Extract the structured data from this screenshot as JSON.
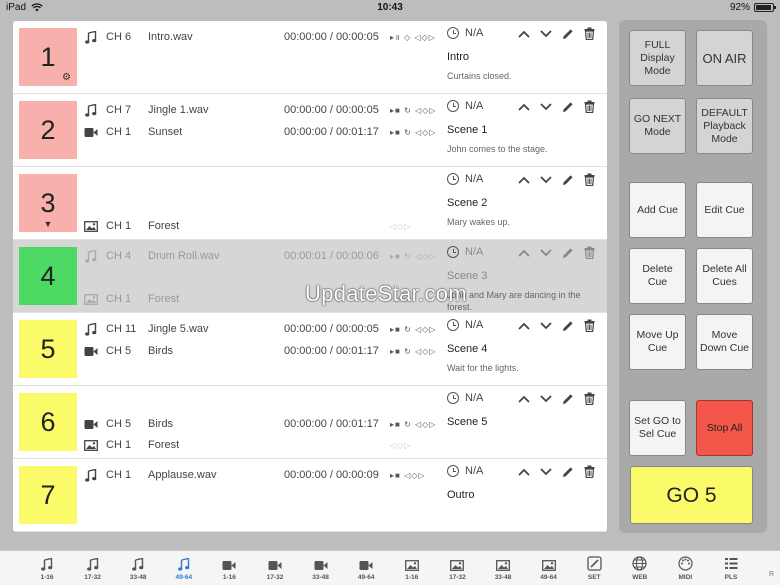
{
  "status_bar": {
    "device": "iPad",
    "time": "10:43",
    "battery_percent": "92%",
    "battery_level": 0.92
  },
  "cues": [
    {
      "number": "1",
      "color": "#f8b0ac",
      "badge": "gear",
      "tracks": [
        {
          "kind": "audio",
          "channel": "CH 6",
          "file": "Intro.wav",
          "time": "00:00:00 / 00:00:05",
          "controls": "▸॥ ◇ ◁◇▷",
          "row": 0
        }
      ],
      "wait": "N/A",
      "title": "Intro",
      "description": "Curtains closed.",
      "selected": false
    },
    {
      "number": "2",
      "color": "#f8b0ac",
      "badge": "",
      "tracks": [
        {
          "kind": "audio",
          "channel": "CH 7",
          "file": "Jingle 1.wav",
          "time": "00:00:00 / 00:00:05",
          "controls": "▸■ ↻ ◁◇▷",
          "row": 0
        },
        {
          "kind": "video",
          "channel": "CH 1",
          "file": "Sunset",
          "time": "00:00:00 / 00:01:17",
          "controls": "▸■ ↻ ◁◇▷",
          "row": 1
        }
      ],
      "wait": "N/A",
      "title": "Scene 1",
      "description": "John comes to the stage.",
      "selected": false
    },
    {
      "number": "3",
      "color": "#f8b0ac",
      "badge": "down",
      "tracks": [
        {
          "kind": "image",
          "channel": "CH 1",
          "file": "Forest",
          "time": "",
          "controls": "◁◇▷",
          "row": 2
        }
      ],
      "wait": "N/A",
      "title": "Scene 2",
      "description": "Mary wakes up.",
      "selected": false
    },
    {
      "number": "4",
      "color": "#4cd964",
      "badge": "",
      "tracks": [
        {
          "kind": "audio",
          "channel": "CH 4",
          "file": "Drum Roll.wav",
          "time": "00:00:01 / 00:00:06",
          "controls": "▸■ ↻ ◁◇▷",
          "row": 0
        },
        {
          "kind": "image",
          "channel": "CH 1",
          "file": "Forest",
          "time": "",
          "controls": "◁◇▷",
          "row": 2
        }
      ],
      "wait": "N/A",
      "title": "Scene 3",
      "description": "John and Mary are dancing in the forest.",
      "selected": true
    },
    {
      "number": "5",
      "color": "#fbfb6a",
      "badge": "",
      "tracks": [
        {
          "kind": "audio",
          "channel": "CH 11",
          "file": "Jingle 5.wav",
          "time": "00:00:00 / 00:00:05",
          "controls": "▸■ ↻ ◁◇▷",
          "row": 0
        },
        {
          "kind": "video",
          "channel": "CH 5",
          "file": "Birds",
          "time": "00:00:00 / 00:01:17",
          "controls": "▸■ ↻ ◁◇▷",
          "row": 1
        }
      ],
      "wait": "N/A",
      "title": "Scene 4",
      "description": "Wait for the lights.",
      "selected": false
    },
    {
      "number": "6",
      "color": "#fbfb6a",
      "badge": "",
      "tracks": [
        {
          "kind": "video",
          "channel": "CH 5",
          "file": "Birds",
          "time": "00:00:00 / 00:01:17",
          "controls": "▸■ ↻ ◁◇▷",
          "row": 1
        },
        {
          "kind": "image",
          "channel": "CH 1",
          "file": "Forest",
          "time": "",
          "controls": "◁◇▷",
          "row": 2
        }
      ],
      "wait": "N/A",
      "title": "Scene 5",
      "description": "",
      "selected": false
    },
    {
      "number": "7",
      "color": "#fbfb6a",
      "badge": "",
      "tracks": [
        {
          "kind": "audio",
          "channel": "CH 1",
          "file": "Applause.wav",
          "time": "00:00:00 / 00:00:09",
          "controls": "▸■ ◁◇▷",
          "row": 0
        }
      ],
      "wait": "N/A",
      "title": "Outro",
      "description": "",
      "selected": false
    }
  ],
  "panel": {
    "full_display": "FULL Display Mode",
    "on_air": "ON AIR",
    "go_next_mode": "GO NEXT Mode",
    "default_playback": "DEFAULT Playback Mode",
    "add_cue": "Add Cue",
    "edit_cue": "Edit Cue",
    "delete_cue": "Delete Cue",
    "delete_all": "Delete All Cues",
    "move_up": "Move Up Cue",
    "move_down": "Move Down Cue",
    "set_go": "Set GO to Sel Cue",
    "stop_all": "Stop All",
    "go": "GO 5"
  },
  "tabs": [
    {
      "icon": "audio",
      "label": "1-16",
      "active": false
    },
    {
      "icon": "audio",
      "label": "17-32",
      "active": false
    },
    {
      "icon": "audio",
      "label": "33-48",
      "active": false
    },
    {
      "icon": "audio",
      "label": "49-64",
      "active": true
    },
    {
      "icon": "video",
      "label": "1-16",
      "active": false
    },
    {
      "icon": "video",
      "label": "17-32",
      "active": false
    },
    {
      "icon": "video",
      "label": "33-48",
      "active": false
    },
    {
      "icon": "video",
      "label": "49-64",
      "active": false
    },
    {
      "icon": "image",
      "label": "1-16",
      "active": false
    },
    {
      "icon": "image",
      "label": "17-32",
      "active": false
    },
    {
      "icon": "image",
      "label": "33-48",
      "active": false
    },
    {
      "icon": "image",
      "label": "49-64",
      "active": false
    },
    {
      "icon": "set",
      "label": "SET",
      "active": false
    },
    {
      "icon": "web",
      "label": "WEB",
      "active": false
    },
    {
      "icon": "midi",
      "label": "MIDI",
      "active": false
    },
    {
      "icon": "pls",
      "label": "PLS",
      "active": false
    }
  ],
  "tab_trailing": "R",
  "watermark": "UpdateStar.com",
  "colors": {
    "active_tab": "#2c7cd6",
    "stop": "#f2574a",
    "go": "#fbfb6a",
    "red_cue": "#f8b0ac",
    "green_cue": "#4cd964",
    "yellow_cue": "#fbfb6a"
  }
}
